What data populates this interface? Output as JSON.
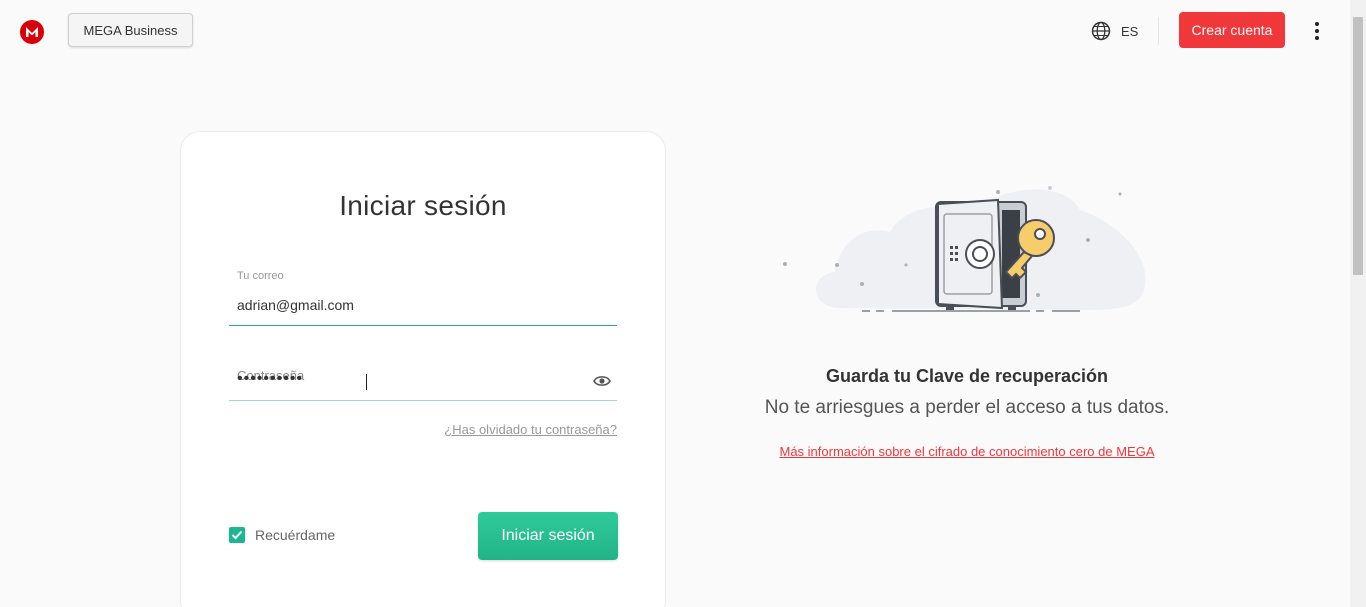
{
  "header": {
    "logo_letter": "M",
    "business_button": "MEGA Business",
    "language_code": "ES",
    "create_account_button": "Crear cuenta",
    "brand_color": "#d90007",
    "accent_red": "#f0373a"
  },
  "login": {
    "title": "Iniciar sesión",
    "email_label": "Tu correo",
    "email_value": "adrian@gmail.com",
    "password_label": "Contraseña",
    "password_value": "••••••••••",
    "forgot_link": "¿Has olvidado tu contraseña?",
    "remember_label": "Recuérdame",
    "remember_checked": true,
    "submit_button": "Iniciar sesión",
    "accent_green": "#22b486"
  },
  "recovery": {
    "title": "Guarda tu Clave de recuperación",
    "subtitle": "No te arriesgues a perder el acceso a tus datos.",
    "link": "Más información sobre el cifrado de conocimiento cero de MEGA"
  },
  "icons": {
    "logo": "mega-logo-icon",
    "language": "globe-icon",
    "menu": "kebab-menu-icon",
    "password_toggle": "eye-icon",
    "checkbox": "checkmark-icon",
    "illustration": "safe-with-key-illustration"
  }
}
